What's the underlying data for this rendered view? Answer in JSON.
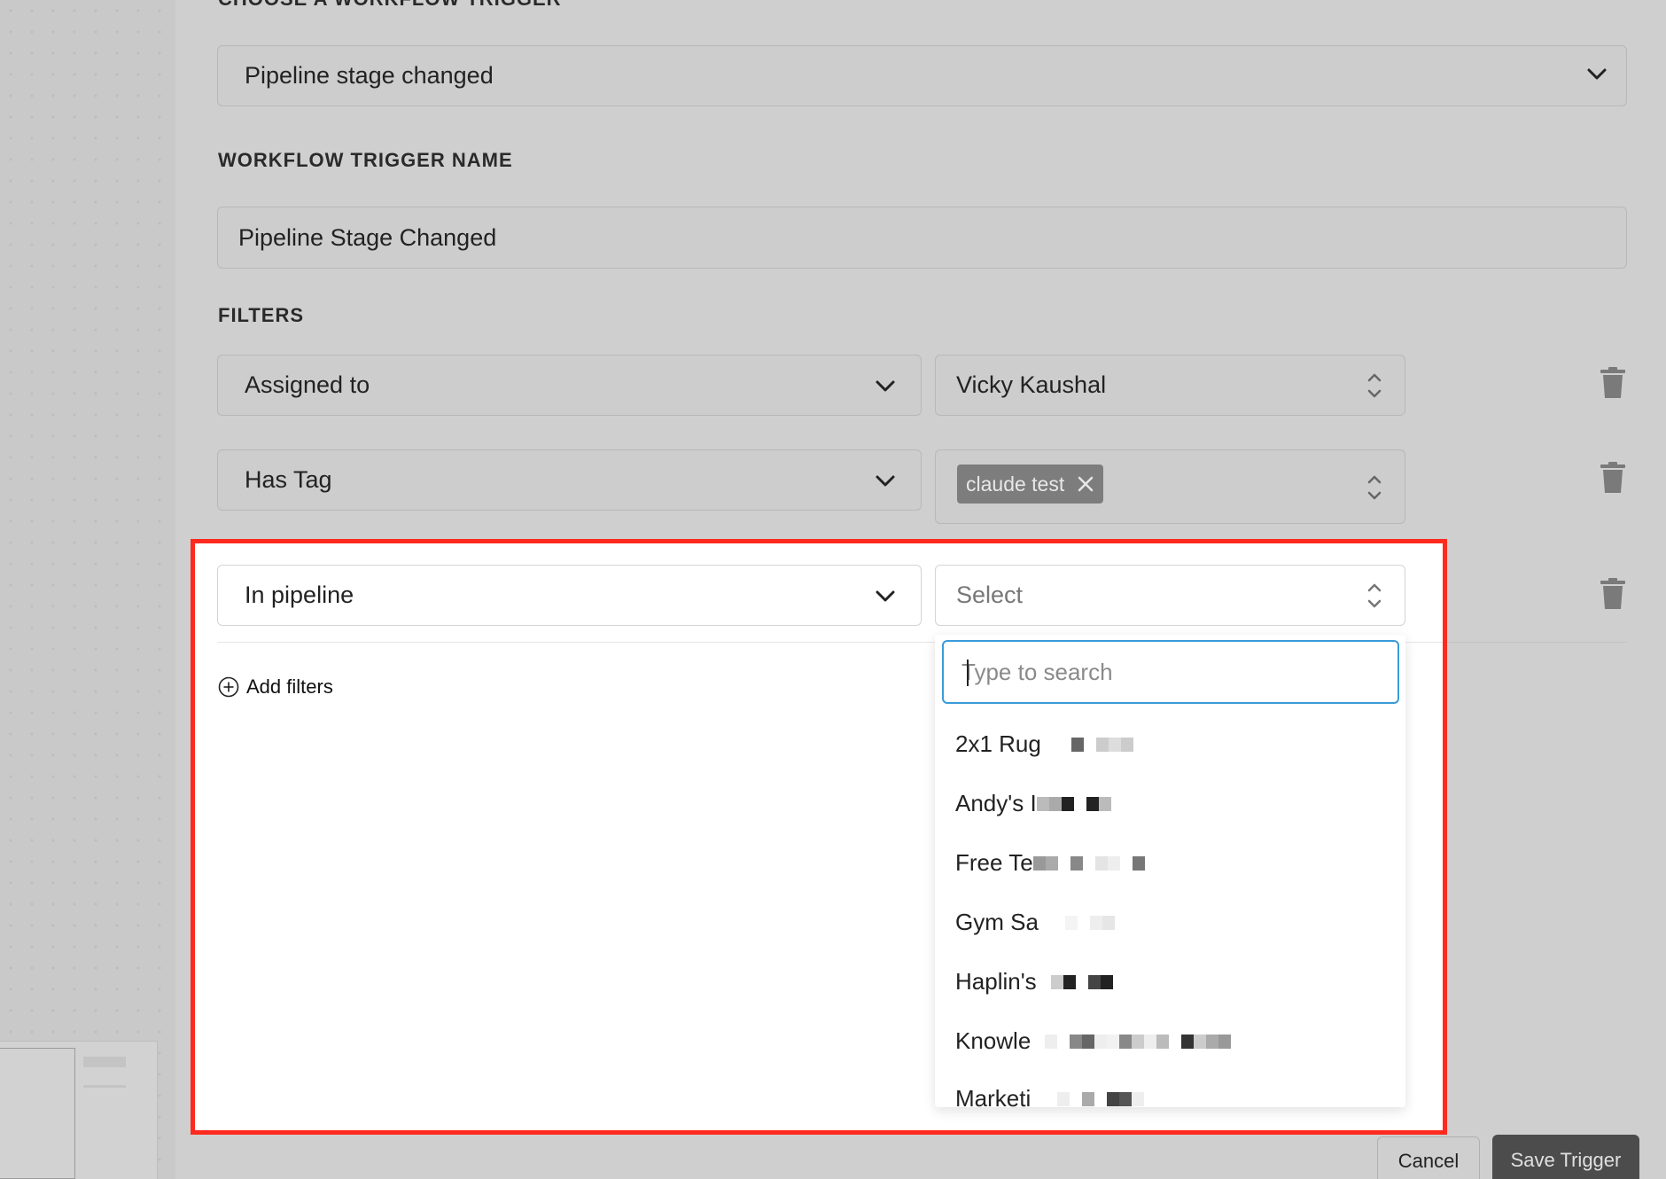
{
  "trigger": {
    "section_label": "CHOOSE A WORKFLOW TRIGGER",
    "selected": "Pipeline stage changed"
  },
  "trigger_name": {
    "section_label": "WORKFLOW TRIGGER NAME",
    "value": "Pipeline Stage Changed"
  },
  "filters": {
    "section_label": "FILTERS",
    "rows": [
      {
        "field": "Assigned to",
        "value": "Vicky Kaushal"
      },
      {
        "field": "Has Tag",
        "tag": "claude test"
      },
      {
        "field": "In pipeline",
        "value_placeholder": "Select"
      }
    ],
    "add_label": "Add filters"
  },
  "pipeline_dropdown": {
    "search_placeholder": "Type to search",
    "options": [
      "2x1 Rug",
      "Andy's I",
      "Free Te",
      "Gym Sa",
      "Haplin's",
      "Knowle",
      "Marketi"
    ]
  },
  "footer": {
    "cancel_label": "Cancel",
    "save_label": "Save Trigger"
  },
  "colors": {
    "highlight_frame": "#ff2a1f",
    "focus_border": "#3a9bd9",
    "tag_bg": "#7d7d7d",
    "save_bg": "#4c4c4c"
  }
}
